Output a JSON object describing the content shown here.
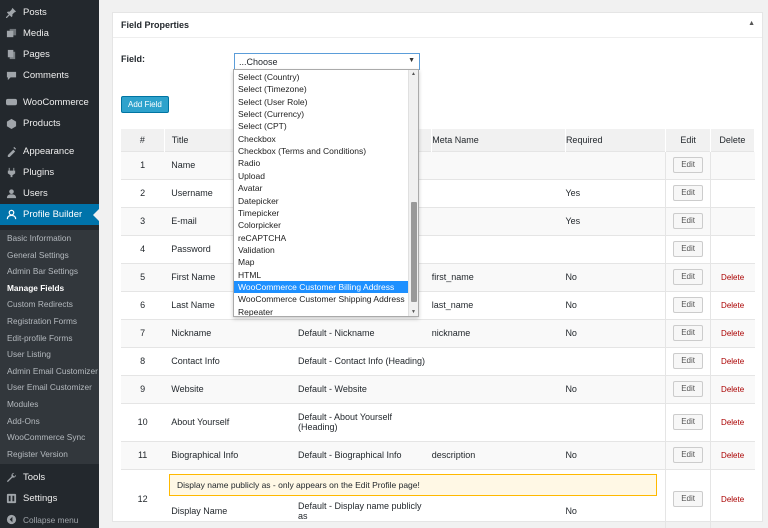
{
  "sidebar": {
    "menu": [
      {
        "label": "Posts",
        "icon": "pin-icon"
      },
      {
        "label": "Media",
        "icon": "media-icon"
      },
      {
        "label": "Pages",
        "icon": "pages-icon"
      },
      {
        "label": "Comments",
        "icon": "comments-icon"
      },
      {
        "label": "WooCommerce",
        "icon": "woocommerce-icon"
      },
      {
        "label": "Products",
        "icon": "products-icon"
      },
      {
        "label": "Appearance",
        "icon": "appearance-icon"
      },
      {
        "label": "Plugins",
        "icon": "plugins-icon"
      },
      {
        "label": "Users",
        "icon": "users-icon"
      },
      {
        "label": "Profile Builder",
        "icon": "profile-builder-icon"
      }
    ],
    "submenu": [
      "Basic Information",
      "General Settings",
      "Admin Bar Settings",
      "Manage Fields",
      "Custom Redirects",
      "Registration Forms",
      "Edit-profile Forms",
      "User Listing",
      "Admin Email Customizer",
      "User Email Customizer",
      "Modules",
      "Add-Ons",
      "WooCommerce Sync",
      "Register Version"
    ],
    "bottom": [
      {
        "label": "Tools",
        "icon": "tools-icon"
      },
      {
        "label": "Settings",
        "icon": "settings-icon"
      },
      {
        "label": "Collapse menu",
        "icon": "collapse-icon"
      }
    ]
  },
  "panel": {
    "title": "Field Properties",
    "field_label": "Field:",
    "select_value": "...Choose",
    "add_button": "Add Field"
  },
  "dropdown": {
    "options": [
      "Select (Country)",
      "Select (Timezone)",
      "Select (User Role)",
      "Select (Currency)",
      "Select (CPT)",
      "Checkbox",
      "Checkbox (Terms and Conditions)",
      "Radio",
      "Upload",
      "Avatar",
      "Datepicker",
      "Timepicker",
      "Colorpicker",
      "reCAPTCHA",
      "Validation",
      "Map",
      "HTML",
      "WooCommerce Customer Billing Address",
      "WooCommerce Customer Shipping Address",
      "Repeater"
    ],
    "highlighted_index": 17
  },
  "table": {
    "headers": {
      "num": "#",
      "title": "Title",
      "meta": "Meta Name",
      "required": "Required",
      "edit": "Edit",
      "delete": "Delete"
    },
    "edit_label": "Edit",
    "delete_label": "Delete",
    "rows": [
      {
        "num": "1",
        "title": "Name",
        "default": "",
        "meta": "",
        "req": "",
        "del": false
      },
      {
        "num": "2",
        "title": "Username",
        "default": "",
        "meta": "",
        "req": "Yes",
        "del": false
      },
      {
        "num": "3",
        "title": "E-mail",
        "default": "",
        "meta": "",
        "req": "Yes",
        "del": false
      },
      {
        "num": "4",
        "title": "Password",
        "default": "",
        "meta": "",
        "req": "",
        "del": false
      },
      {
        "num": "5",
        "title": "First Name",
        "default": "",
        "meta": "first_name",
        "req": "No",
        "del": true
      },
      {
        "num": "6",
        "title": "Last Name",
        "default": "",
        "meta": "last_name",
        "req": "No",
        "del": true
      },
      {
        "num": "7",
        "title": "Nickname",
        "default": "Default - Nickname",
        "meta": "nickname",
        "req": "No",
        "del": true
      },
      {
        "num": "8",
        "title": "Contact Info",
        "default": "Default - Contact Info (Heading)",
        "meta": "",
        "req": "",
        "del": true
      },
      {
        "num": "9",
        "title": "Website",
        "default": "Default - Website",
        "meta": "",
        "req": "No",
        "del": true
      },
      {
        "num": "10",
        "title": "About Yourself",
        "default": "Default - About Yourself (Heading)",
        "meta": "",
        "req": "",
        "del": true
      },
      {
        "num": "11",
        "title": "Biographical Info",
        "default": "Default - Biographical Info",
        "meta": "description",
        "req": "No",
        "del": true
      },
      {
        "num": "12",
        "title": "Display Name",
        "default": "Default - Display name publicly as",
        "meta": "",
        "req": "No",
        "del": true,
        "notice": "Display name publicly as - only appears on the Edit Profile page!"
      }
    ]
  }
}
